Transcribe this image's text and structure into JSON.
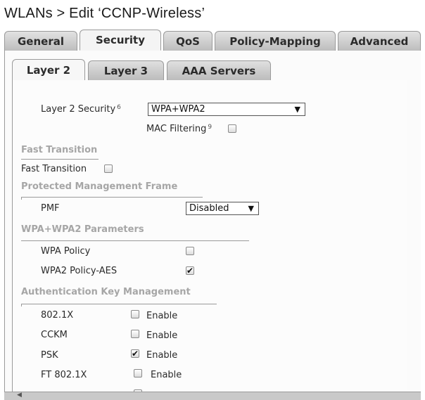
{
  "title": "WLANs > Edit ‘CCNP-Wireless’",
  "main_tabs": [
    "General",
    "Security",
    "QoS",
    "Policy-Mapping",
    "Advanced"
  ],
  "active_main_tab": "Security",
  "sub_tabs": [
    "Layer 2",
    "Layer 3",
    "AAA Servers"
  ],
  "active_sub_tab": "Layer 2",
  "layer2": {
    "security_label": "Layer 2 Security",
    "security_help": "6",
    "security_value": "WPA+WPA2",
    "mac_filtering_label": "MAC Filtering",
    "mac_filtering_help": "9",
    "mac_filtering_checked": false
  },
  "fast_transition": {
    "section": "Fast Transition",
    "label": "Fast Transition",
    "checked": false
  },
  "pmf": {
    "section": "Protected Management Frame",
    "label": "PMF",
    "value": "Disabled"
  },
  "wpa": {
    "section": "WPA+WPA2 Parameters",
    "wpa_policy_label": "WPA Policy",
    "wpa_policy_checked": false,
    "wpa2_aes_label": "WPA2 Policy-AES",
    "wpa2_aes_checked": true
  },
  "akm": {
    "section": "Authentication Key Management",
    "enable_label": "Enable",
    "rows": [
      {
        "label": "802.1X",
        "checked": false
      },
      {
        "label": "CCKM",
        "checked": false
      },
      {
        "label": "PSK",
        "checked": true
      },
      {
        "label": "FT 802.1X",
        "checked": false
      }
    ]
  },
  "icons": {
    "checkmark": "✔",
    "dropdown": "▼",
    "scroll-left": "◀"
  }
}
